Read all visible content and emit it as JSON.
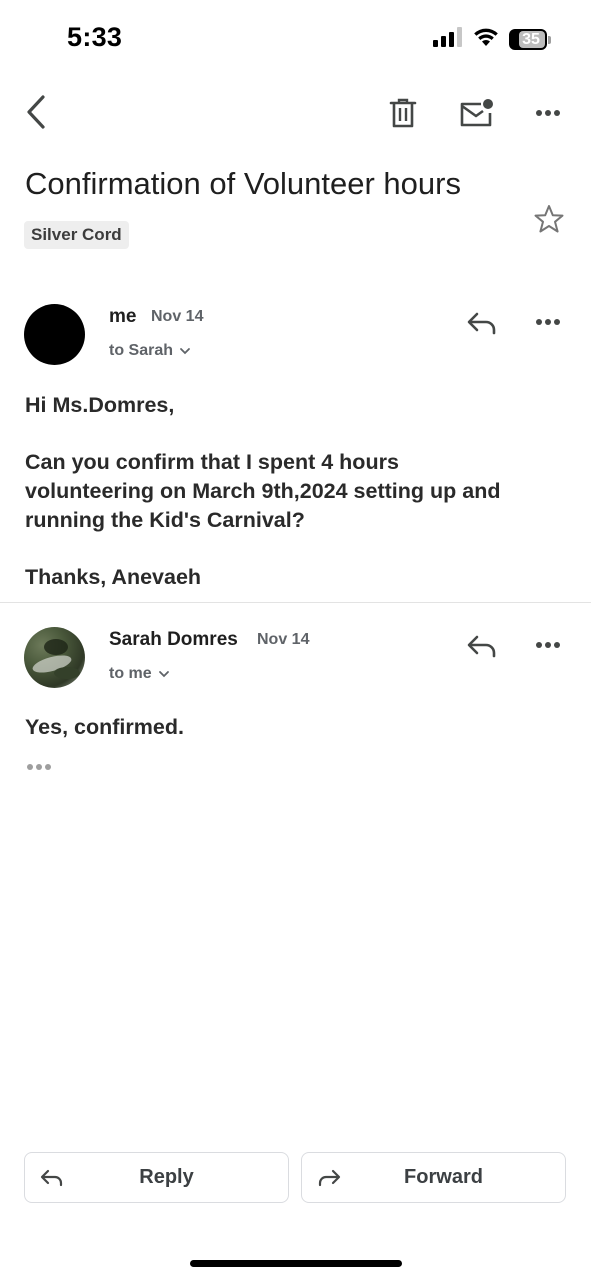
{
  "status_bar": {
    "time": "5:33",
    "battery": "35",
    "icons": [
      "signal-icon",
      "wifi-icon",
      "battery-icon"
    ]
  },
  "toolbar": {
    "icons": [
      "back-icon",
      "trash-icon",
      "mark-unread-icon",
      "more-icon"
    ]
  },
  "email": {
    "subject": "Confirmation of Volunteer hours",
    "label": "Silver Cord"
  },
  "messages": [
    {
      "sender": "me",
      "date": "Nov 14",
      "to": "to Sarah",
      "body": {
        "greeting": "Hi Ms.Domres,",
        "line1": "Can you confirm that I spent 4 hours",
        "line2": "volunteering on March 9th,2024 setting up and",
        "line3": "running the Kid's Carnival?",
        "signoff": "Thanks, Anevaeh"
      }
    },
    {
      "sender": "Sarah Domres",
      "date": "Nov 14",
      "to": "to me",
      "body": {
        "text": "Yes, confirmed."
      }
    }
  ],
  "actions": {
    "reply": "Reply",
    "forward": "Forward"
  },
  "colors": {
    "text": "#1f1f1f",
    "secondary": "#5f6368",
    "icon": "#444746",
    "border": "#dadce0"
  }
}
